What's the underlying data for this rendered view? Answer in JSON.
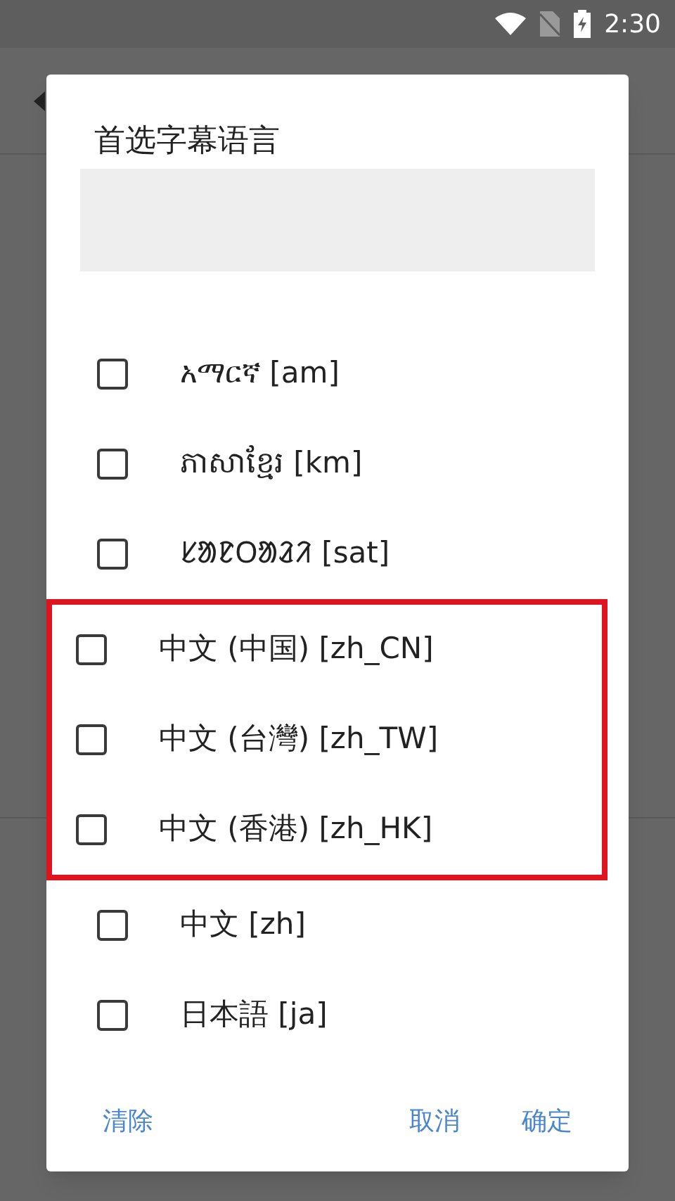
{
  "status_bar": {
    "time": "2:30"
  },
  "dialog": {
    "title": "首选字幕语言",
    "items": [
      {
        "label": "አማርኛ [am]",
        "checked": false,
        "highlighted": false
      },
      {
        "label": "ភាសាខ្មែរ [km]",
        "checked": false,
        "highlighted": false
      },
      {
        "label": "ᱥᱟᱱᱛᱟᱲᱤ [sat]",
        "checked": false,
        "highlighted": false
      },
      {
        "label": "中文 (中国) [zh_CN]",
        "checked": false,
        "highlighted": true
      },
      {
        "label": "中文 (台灣) [zh_TW]",
        "checked": false,
        "highlighted": true
      },
      {
        "label": "中文 (香港) [zh_HK]",
        "checked": false,
        "highlighted": true
      },
      {
        "label": "中文 [zh]",
        "checked": false,
        "highlighted": false
      },
      {
        "label": "日本語 [ja]",
        "checked": false,
        "highlighted": false
      }
    ],
    "buttons": {
      "left": "清除",
      "cancel": "取消",
      "ok": "确定"
    }
  }
}
